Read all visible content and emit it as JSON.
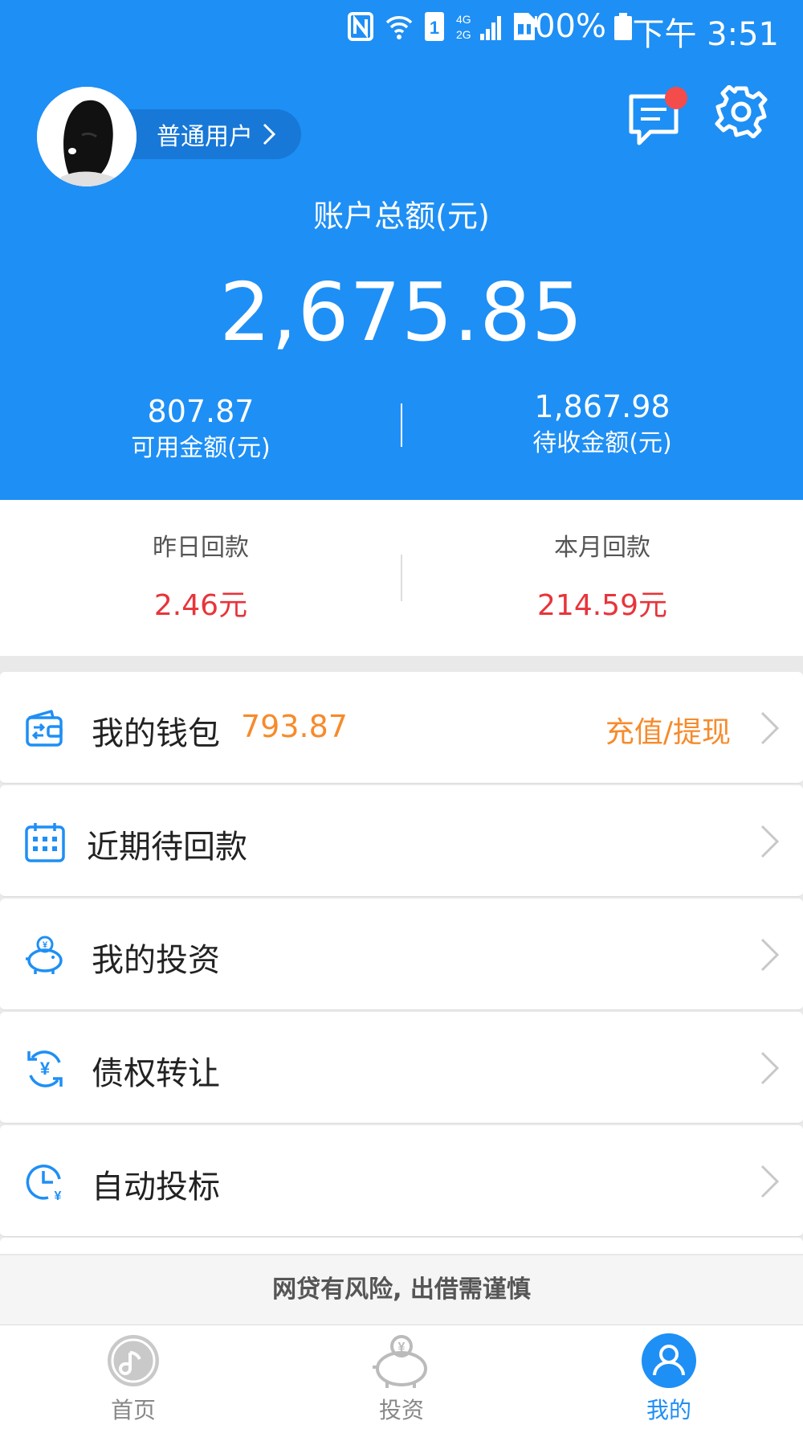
{
  "status_bar": {
    "battery": "100%",
    "time": "下午 3:51",
    "network": "4G 2G"
  },
  "user": {
    "level_label": "普通用户"
  },
  "account": {
    "total_label": "账户总额(元)",
    "total_value": "2,675.85",
    "available_value": "807.87",
    "available_label": "可用金额(元)",
    "pending_value": "1,867.98",
    "pending_label": "待收金额(元)"
  },
  "returns": {
    "yesterday_label": "昨日回款",
    "yesterday_value": "2.46元",
    "month_label": "本月回款",
    "month_value": "214.59元"
  },
  "menu": [
    {
      "label": "我的钱包",
      "amount": "793.87",
      "action": "充值/提现",
      "icon": "wallet-icon"
    },
    {
      "label": "近期待回款",
      "icon": "calendar-icon"
    },
    {
      "label": "我的投资",
      "icon": "piggy-bank-icon"
    },
    {
      "label": "债权转让",
      "icon": "yuan-transfer-icon"
    },
    {
      "label": "自动投标",
      "icon": "clock-yuan-icon"
    }
  ],
  "notice": "网贷有风险, 出借需谨慎",
  "nav": [
    {
      "label": "首页",
      "icon": "home-icon"
    },
    {
      "label": "投资",
      "icon": "invest-icon"
    },
    {
      "label": "我的",
      "icon": "profile-icon",
      "active": true
    }
  ],
  "colors": {
    "primary": "#1e8ff5",
    "accent_orange": "#f68b2c",
    "accent_red": "#e8343a",
    "badge": "#f44b4b"
  }
}
